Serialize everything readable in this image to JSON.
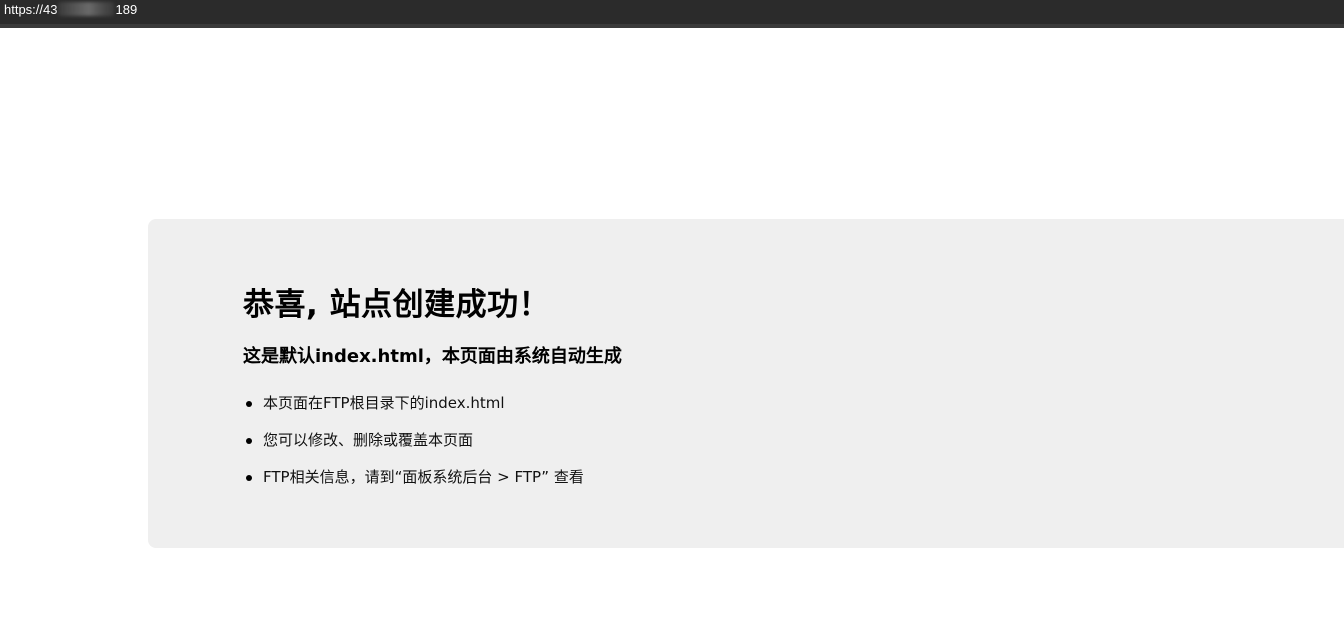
{
  "browser": {
    "url_start": "https://43",
    "url_end": "189"
  },
  "page": {
    "title": "恭喜, 站点创建成功！",
    "subtitle": "这是默认index.html，本页面由系统自动生成",
    "items": [
      "本页面在FTP根目录下的index.html",
      "您可以修改、删除或覆盖本页面",
      "FTP相关信息，请到“面板系统后台 > FTP” 查看"
    ]
  }
}
